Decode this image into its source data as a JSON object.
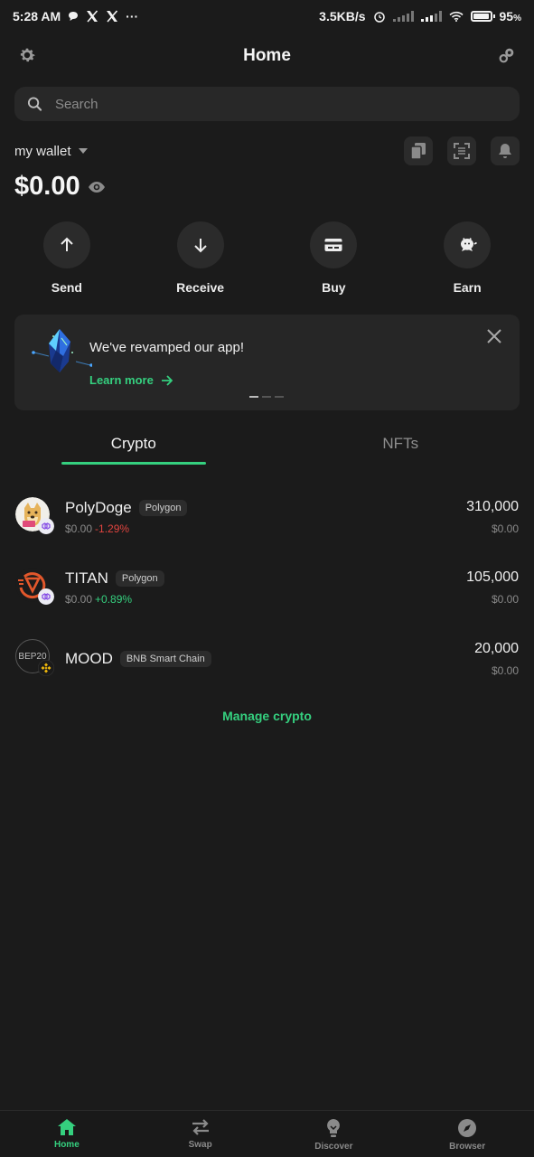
{
  "status_bar": {
    "time": "5:28 AM",
    "notif_icons": [
      "chat-bubble-icon",
      "x-logo-icon",
      "x-logo-icon",
      "more-icon"
    ],
    "net_speed": "3.5KB/s",
    "battery_pct": "95"
  },
  "header": {
    "title": "Home"
  },
  "search": {
    "placeholder": "Search"
  },
  "wallet": {
    "name": "my wallet",
    "balance": "$0.00"
  },
  "actions": [
    {
      "label": "Send",
      "icon": "arrow-up-icon"
    },
    {
      "label": "Receive",
      "icon": "arrow-down-icon"
    },
    {
      "label": "Buy",
      "icon": "card-icon"
    },
    {
      "label": "Earn",
      "icon": "piggy-icon"
    }
  ],
  "banner": {
    "title": "We've revamped our app!",
    "link": "Learn more"
  },
  "tabs": {
    "crypto": "Crypto",
    "nfts": "NFTs"
  },
  "tokens": [
    {
      "name": "PolyDoge",
      "chain": "Polygon",
      "price": "$0.00",
      "change": "-1.29%",
      "amount": "310,000",
      "value": "$0.00"
    },
    {
      "name": "TITAN",
      "chain": "Polygon",
      "price": "$0.00",
      "change": "+0.89%",
      "amount": "105,000",
      "value": "$0.00"
    },
    {
      "name": "MOOD",
      "chain": "BNB Smart Chain",
      "amount": "20,000",
      "value": "$0.00",
      "logo_text": "BEP20"
    }
  ],
  "manage_label": "Manage crypto",
  "bottom_nav": [
    {
      "label": "Home",
      "icon": "home-icon",
      "active": true
    },
    {
      "label": "Swap",
      "icon": "swap-icon"
    },
    {
      "label": "Discover",
      "icon": "bulb-icon"
    },
    {
      "label": "Browser",
      "icon": "compass-icon"
    }
  ],
  "colors": {
    "accent": "#35d07f",
    "negative": "#e0443f",
    "background": "#1b1b1b"
  }
}
